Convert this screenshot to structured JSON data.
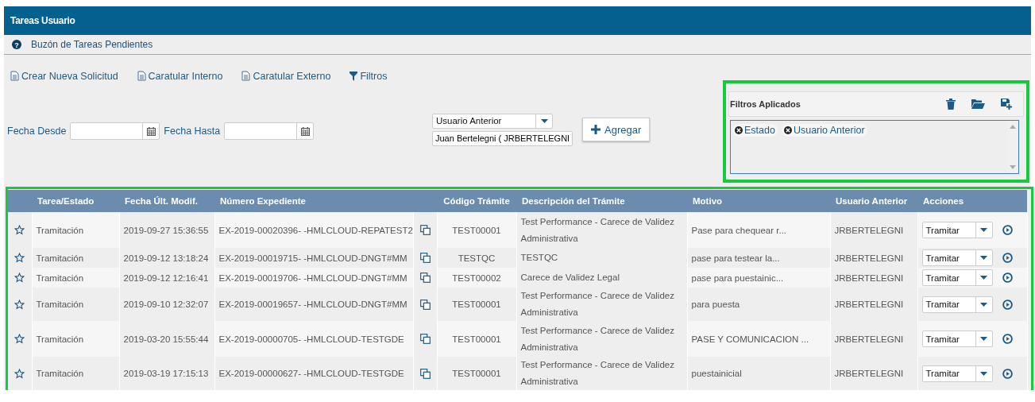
{
  "window": {
    "title": "Tareas Usuario"
  },
  "help_icon": "?",
  "subtitle": "Buzón de Tareas Pendientes",
  "toolbar": [
    "Crear Nueva Solicitud",
    "Caratular Interno",
    "Caratular Externo",
    "Filtros"
  ],
  "date_filters": [
    {
      "label": "Fecha Desde"
    },
    {
      "label": "Fecha Hasta"
    }
  ],
  "filter_select": {
    "value": "Usuario Anterior"
  },
  "filter_value": {
    "value": "Juan Bertelegni ( JRBERTELEGNI"
  },
  "add_button": "Agregar",
  "applied_filters": {
    "title": "Filtros Aplicados",
    "tags": [
      "Estado",
      "Usuario Anterior"
    ]
  },
  "table": {
    "columns": [
      "Tarea/Estado",
      "Fecha Últ. Modif.",
      "Número Expediente",
      "Código Trámite",
      "Descripción del Trámite",
      "Motivo",
      "Usuario Anterior",
      "Acciones"
    ],
    "rows": [
      {
        "tarea": "Tramitación",
        "fecha": "2019-09-27 15:36:55",
        "numero": "EX-2019-00020396- -HMLCLOUD-REPATEST2",
        "codigo": "TEST00001",
        "descripcion": "Test Performance - Carece de Validez Administrativa",
        "motivo": "Pase para chequear r...",
        "usuario": "JRBERTELEGNI",
        "accion": "Tramitar"
      },
      {
        "tarea": "Tramitación",
        "fecha": "2019-09-12 13:18:24",
        "numero": "EX-2019-00019715- -HMLCLOUD-DNGT#MM",
        "codigo": "TESTQC",
        "descripcion": "TESTQC",
        "motivo": "pase para testear la...",
        "usuario": "JRBERTELEGNI",
        "accion": "Tramitar"
      },
      {
        "tarea": "Tramitación",
        "fecha": "2019-09-12 12:16:41",
        "numero": "EX-2019-00019706- -HMLCLOUD-DNGT#MM",
        "codigo": "TEST00002",
        "descripcion": "Carece de Validez Legal",
        "motivo": "pase para puestainic...",
        "usuario": "JRBERTELEGNI",
        "accion": "Tramitar"
      },
      {
        "tarea": "Tramitación",
        "fecha": "2019-09-10 12:32:07",
        "numero": "EX-2019-00019657- -HMLCLOUD-DNGT#MM",
        "codigo": "TEST00001",
        "descripcion": "Test Performance - Carece de Validez Administrativa",
        "motivo": "para puesta",
        "usuario": "JRBERTELEGNI",
        "accion": "Tramitar"
      },
      {
        "tarea": "Tramitación",
        "fecha": "2019-03-20 15:55:44",
        "numero": "EX-2019-00000705- -HMLCLOUD-TESTGDE",
        "codigo": "TEST00001",
        "descripcion": "Test Performance - Carece de Validez Administrativa",
        "motivo": "PASE Y COMUNICACION ...",
        "usuario": "JRBERTELEGNI",
        "accion": "Tramitar"
      },
      {
        "tarea": "Tramitación",
        "fecha": "2019-03-19 17:15:13",
        "numero": "EX-2019-00000627- -HMLCLOUD-TESTGDE",
        "codigo": "TEST00001",
        "descripcion": "Test Performance - Carece de Validez Administrativa",
        "motivo": "puestainicial",
        "usuario": "JRBERTELEGNI",
        "accion": "Tramitar"
      }
    ]
  }
}
